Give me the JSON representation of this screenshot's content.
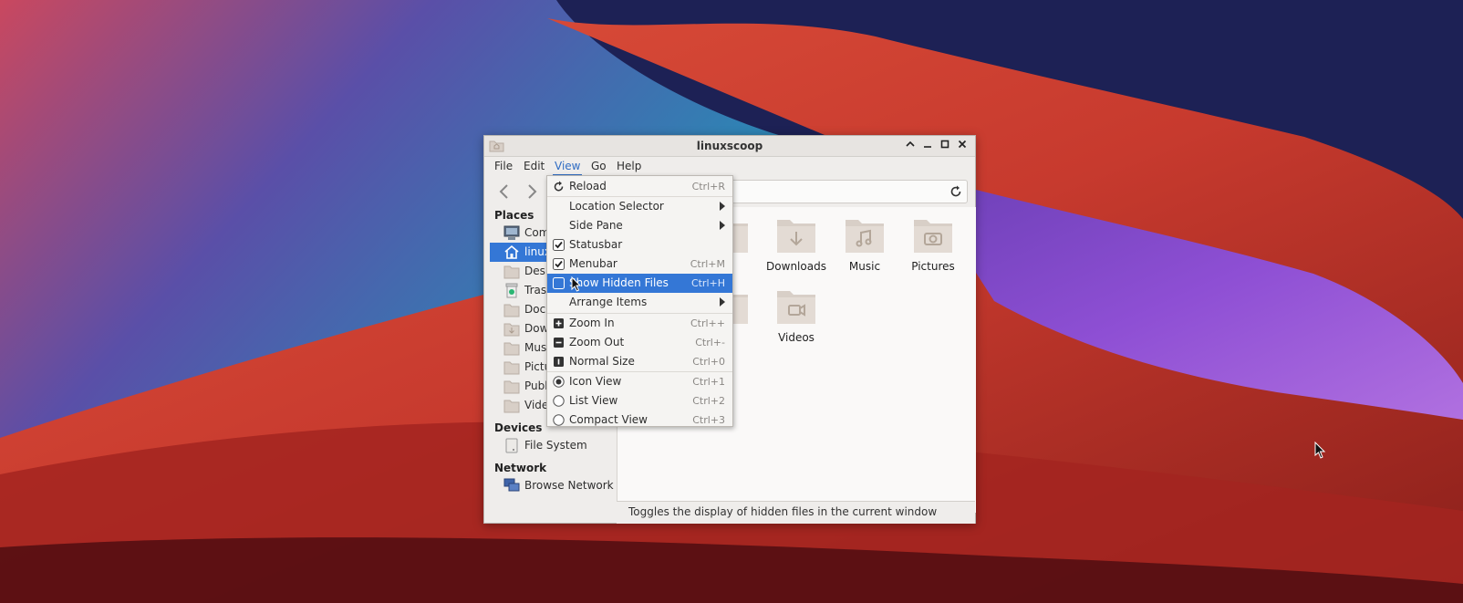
{
  "window": {
    "title": "linuxscoop"
  },
  "menubar": [
    "File",
    "Edit",
    "View",
    "Go",
    "Help"
  ],
  "view_menu": {
    "items": [
      {
        "label": "Reload",
        "shortcut": "Ctrl+R"
      },
      {
        "label": "Location Selector"
      },
      {
        "label": "Side Pane"
      },
      {
        "label": "Statusbar"
      },
      {
        "label": "Menubar",
        "shortcut": "Ctrl+M"
      },
      {
        "label": "Show Hidden Files",
        "shortcut": "Ctrl+H"
      },
      {
        "label": "Arrange Items"
      },
      {
        "label": "Zoom In",
        "shortcut": "Ctrl++"
      },
      {
        "label": "Zoom Out",
        "shortcut": "Ctrl+-"
      },
      {
        "label": "Normal Size",
        "shortcut": "Ctrl+0"
      },
      {
        "label": "Icon View",
        "shortcut": "Ctrl+1"
      },
      {
        "label": "List View",
        "shortcut": "Ctrl+2"
      },
      {
        "label": "Compact View",
        "shortcut": "Ctrl+3"
      }
    ]
  },
  "sidebar": {
    "places_header": "Places",
    "places": [
      "Comp",
      "linux",
      "Deskt",
      "Trash",
      "Docu",
      "Down",
      "Music",
      "Pictur",
      "Public",
      "Video"
    ],
    "devices_header": "Devices",
    "devices": [
      "File System"
    ],
    "network_header": "Network",
    "network": [
      "Browse Network"
    ]
  },
  "files": {
    "partial_1": "nts",
    "partial_2": "tes",
    "downloads": "Downloads",
    "music": "Music",
    "pictures": "Pictures",
    "videos": "Videos"
  },
  "statusbar": "Toggles the display of hidden files in the current window",
  "colors": {
    "accent": "#3477d6",
    "folder": "#d8cfc7"
  }
}
